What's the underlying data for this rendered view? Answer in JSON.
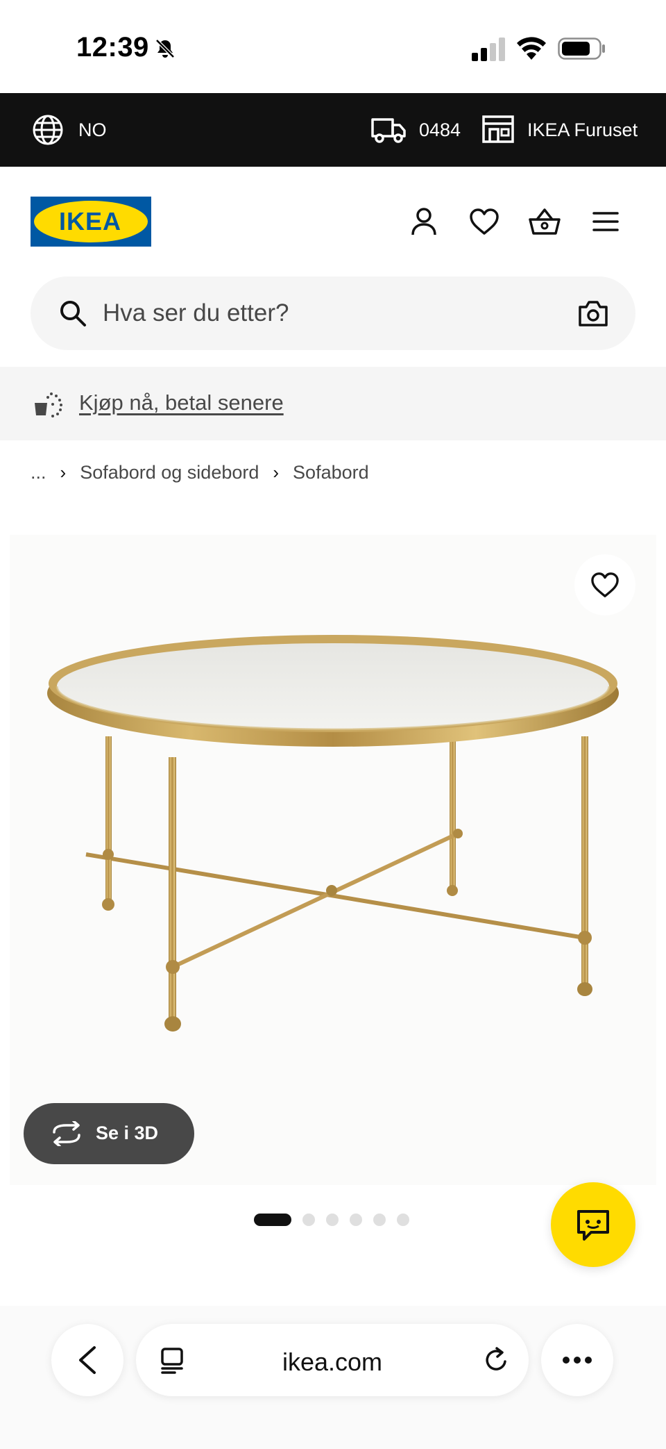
{
  "status_bar": {
    "time": "12:39"
  },
  "top_bar": {
    "language": "NO",
    "postal_code": "0484",
    "store": "IKEA Furuset"
  },
  "header": {
    "logo_text": "IKEA"
  },
  "search": {
    "placeholder": "Hva ser du etter?"
  },
  "promo": {
    "link_text": "Kjøp nå, betal senere"
  },
  "breadcrumb": {
    "ellipsis": "...",
    "items": [
      "Sofabord og sidebord",
      "Sofabord"
    ]
  },
  "product": {
    "see_3d_label": "Se i 3D",
    "carousel": {
      "total": 6,
      "active": 1
    }
  },
  "browser": {
    "url": "ikea.com"
  },
  "colors": {
    "ikea_blue": "#0058a3",
    "ikea_yellow": "#ffdb00",
    "dark_bar": "#111111",
    "button_grey": "#484848"
  }
}
